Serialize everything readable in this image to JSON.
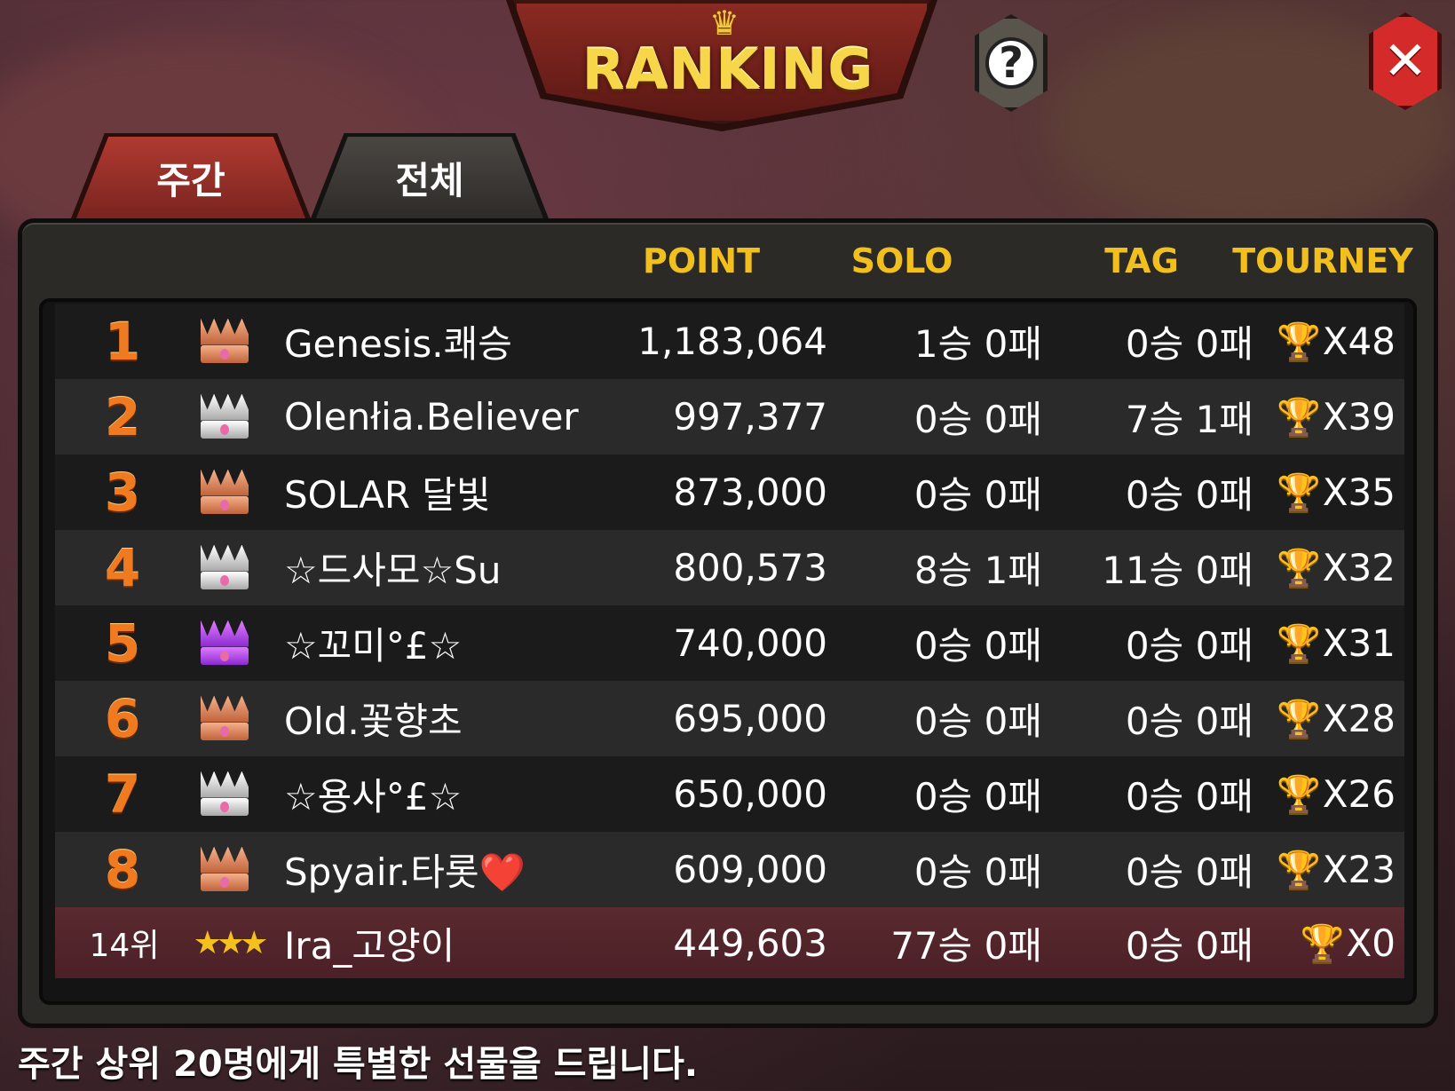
{
  "header": {
    "title": "RANKING",
    "crown_icon": "crown-icon",
    "help_label": "?",
    "close_label": "✕"
  },
  "tabs": [
    {
      "label": "주간",
      "active": true
    },
    {
      "label": "전체",
      "active": false
    }
  ],
  "columns": {
    "point": "POINT",
    "solo": "SOLO",
    "tag": "TAG",
    "tourney": "TOURNEY"
  },
  "rows": [
    {
      "rank": "1",
      "crown": "bronze",
      "name": "Genesis.쾌승",
      "point": "1,183,064",
      "solo": "1승 0패",
      "tag": "0승 0패",
      "tourney": "X48"
    },
    {
      "rank": "2",
      "crown": "silver",
      "name": "Olenłia.Believer",
      "point": "997,377",
      "solo": "0승 0패",
      "tag": "7승 1패",
      "tourney": "X39"
    },
    {
      "rank": "3",
      "crown": "bronze",
      "name": "SOLAR 달빛",
      "point": "873,000",
      "solo": "0승 0패",
      "tag": "0승 0패",
      "tourney": "X35"
    },
    {
      "rank": "4",
      "crown": "silver",
      "name": "☆드사모☆Su",
      "point": "800,573",
      "solo": "8승 1패",
      "tag": "11승 0패",
      "tourney": "X32"
    },
    {
      "rank": "5",
      "crown": "purple",
      "name": "☆꼬미°£☆",
      "point": "740,000",
      "solo": "0승 0패",
      "tag": "0승 0패",
      "tourney": "X31"
    },
    {
      "rank": "6",
      "crown": "bronze",
      "name": "Old.꽃향초",
      "point": "695,000",
      "solo": "0승 0패",
      "tag": "0승 0패",
      "tourney": "X28"
    },
    {
      "rank": "7",
      "crown": "silver",
      "name": "☆용사°£☆",
      "point": "650,000",
      "solo": "0승 0패",
      "tag": "0승 0패",
      "tourney": "X26"
    },
    {
      "rank": "8",
      "crown": "bronze",
      "name": "Spyair.타롯❤️",
      "point": "609,000",
      "solo": "0승 0패",
      "tag": "0승 0패",
      "tourney": "X23"
    }
  ],
  "my_row": {
    "rank": "14위",
    "stars": "★★★",
    "name": "Ira_고양이",
    "point": "449,603",
    "solo": "77승 0패",
    "tag": "0승 0패",
    "tourney": "X0"
  },
  "trophy_icon": "trophy-icon",
  "footer": "주간 상위 20명에게 특별한 선물을 드립니다.",
  "colors": {
    "accent": "#f2c01e",
    "rank": "#f07a20",
    "my_row": "#4a2026",
    "close": "#d42a2a"
  }
}
